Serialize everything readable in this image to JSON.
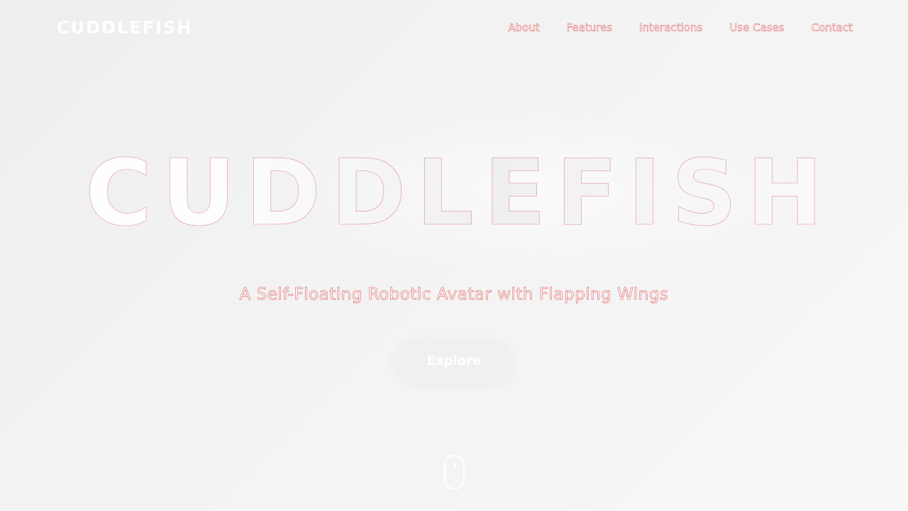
{
  "header": {
    "logo_text": "CUDDLEFISH",
    "nav_items": [
      {
        "label": "About"
      },
      {
        "label": "Features"
      },
      {
        "label": "Interactions"
      },
      {
        "label": "Use Cases"
      },
      {
        "label": "Contact"
      }
    ]
  },
  "hero": {
    "title": "CUDDLEFISH",
    "subtitle": "A Self-Floating Robotic Avatar with Flapping Wings",
    "cta_label": "Explore"
  },
  "icons": {
    "scroll_indicator": "mouse-scroll-icon"
  },
  "colors": {
    "background": "#f2f2f2",
    "text": "#ffffff",
    "outline": "#d63b3b"
  }
}
